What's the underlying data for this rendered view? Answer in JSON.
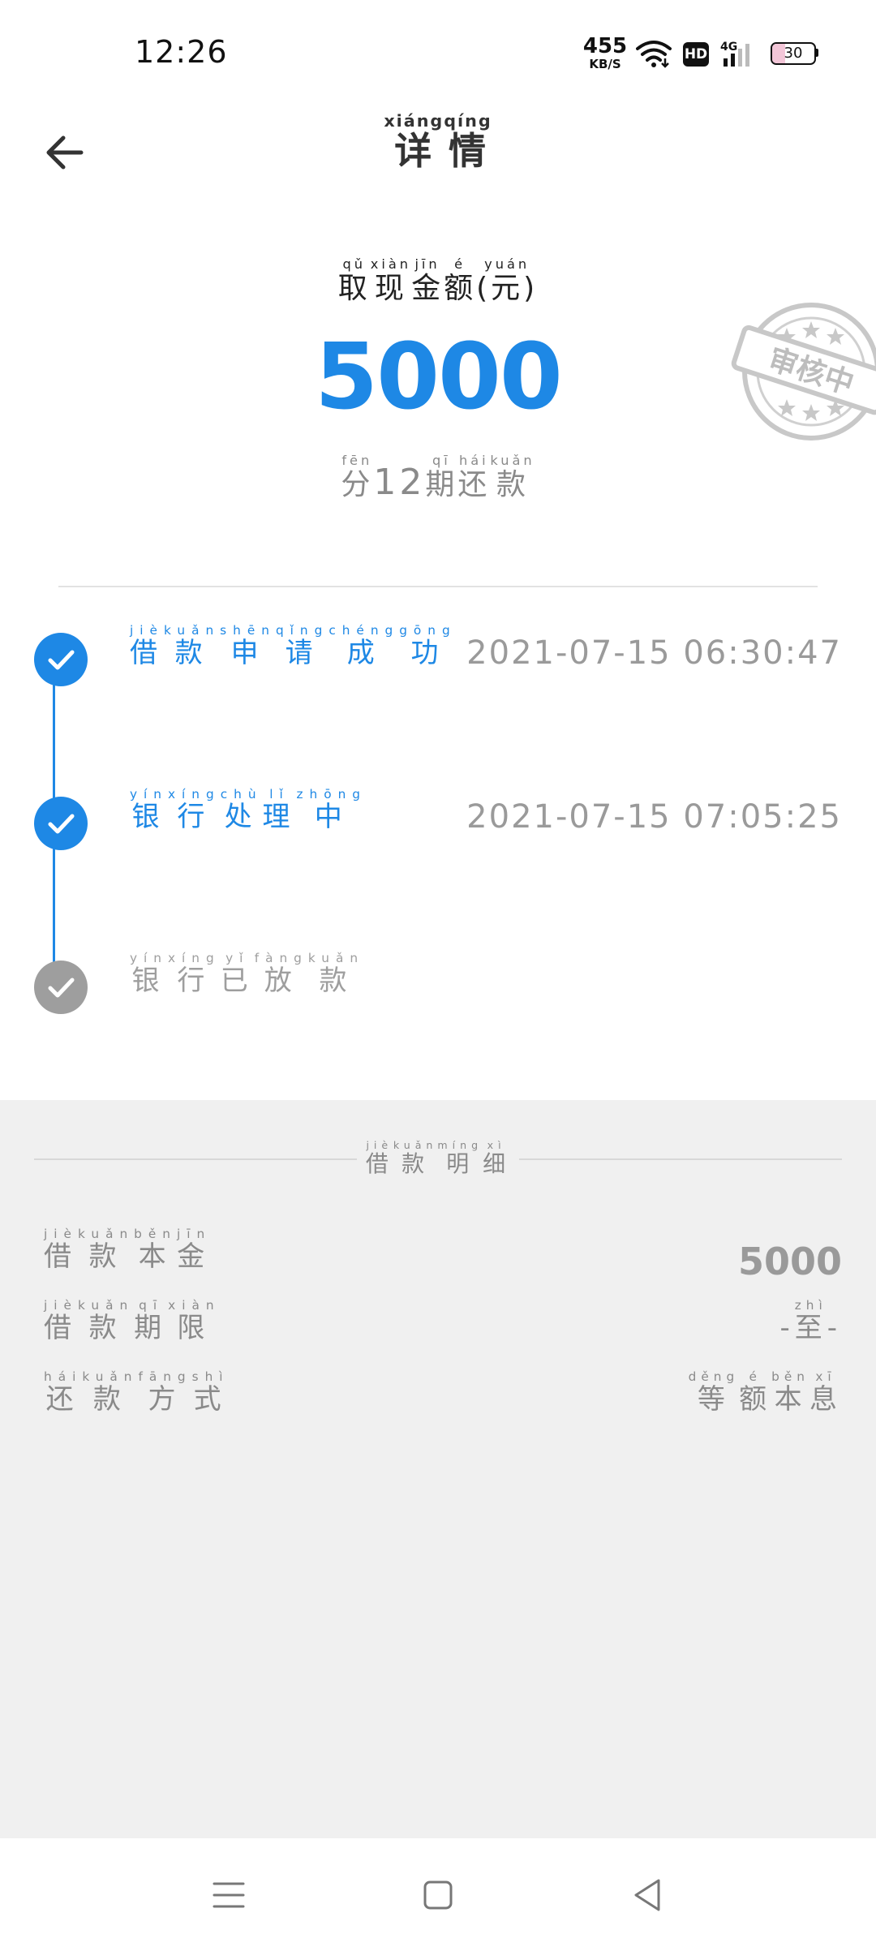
{
  "status_bar": {
    "time": "12:26",
    "net_speed_value": "455",
    "net_speed_unit": "KB/S",
    "hd_label": "HD",
    "network_type": "4G",
    "battery_level": "30",
    "battery_fill_color": "#f3c6d8"
  },
  "header": {
    "title": [
      {
        "char": "详",
        "pinyin": "xiáng"
      },
      {
        "char": "情",
        "pinyin": "qíng"
      }
    ],
    "back_icon": "arrow-left-icon"
  },
  "amount": {
    "label": [
      {
        "char": "取",
        "pinyin": "qǔ"
      },
      {
        "char": "现",
        "pinyin": "xiàn"
      },
      {
        "char": "金",
        "pinyin": "jīn"
      },
      {
        "char": "额",
        "pinyin": "é"
      },
      {
        "char": "(",
        "pinyin": ""
      },
      {
        "char": "元",
        "pinyin": "yuán"
      },
      {
        "char": ")",
        "pinyin": ""
      }
    ],
    "value": "5000",
    "term": [
      {
        "char": "分",
        "pinyin": "fēn"
      },
      {
        "char": "12",
        "pinyin": ""
      },
      {
        "char": "期",
        "pinyin": "qī"
      },
      {
        "char": "还",
        "pinyin": "hái"
      },
      {
        "char": "款",
        "pinyin": "kuǎn"
      }
    ],
    "stamp_text": "审核中",
    "accent_color": "#1e88e5"
  },
  "timeline": {
    "steps": [
      {
        "label": [
          {
            "char": "借",
            "pinyin": "jiè"
          },
          {
            "char": "款",
            "pinyin": "kuǎn"
          },
          {
            "char": "申",
            "pinyin": "shēn"
          },
          {
            "char": "请",
            "pinyin": "qǐng"
          },
          {
            "char": "成",
            "pinyin": "chéng"
          },
          {
            "char": "功",
            "pinyin": "gōng"
          }
        ],
        "time": "2021-07-15 06:30:47",
        "status": "done",
        "color": "#1e88e5"
      },
      {
        "label": [
          {
            "char": "银",
            "pinyin": "yín"
          },
          {
            "char": "行",
            "pinyin": "xíng"
          },
          {
            "char": "处",
            "pinyin": "chù"
          },
          {
            "char": "理",
            "pinyin": "lǐ"
          },
          {
            "char": "中",
            "pinyin": "zhōng"
          }
        ],
        "time": "2021-07-15 07:05:25",
        "status": "done",
        "color": "#1e88e5"
      },
      {
        "label": [
          {
            "char": "银",
            "pinyin": "yín"
          },
          {
            "char": "行",
            "pinyin": "xíng"
          },
          {
            "char": "已",
            "pinyin": "yǐ"
          },
          {
            "char": "放",
            "pinyin": "fàng"
          },
          {
            "char": "款",
            "pinyin": "kuǎn"
          }
        ],
        "time": "",
        "status": "pending",
        "color": "#9e9e9e"
      }
    ]
  },
  "details": {
    "title": [
      {
        "char": "借",
        "pinyin": "jiè"
      },
      {
        "char": "款",
        "pinyin": "kuǎn"
      },
      {
        "char": "明",
        "pinyin": "míng"
      },
      {
        "char": "细",
        "pinyin": "xì"
      }
    ],
    "rows": [
      {
        "label": [
          {
            "char": "借",
            "pinyin": "jiè"
          },
          {
            "char": "款",
            "pinyin": "kuǎn"
          },
          {
            "char": "本",
            "pinyin": "běn"
          },
          {
            "char": "金",
            "pinyin": "jīn"
          }
        ],
        "value": [
          {
            "char": "5000",
            "pinyin": ""
          }
        ]
      },
      {
        "label": [
          {
            "char": "借",
            "pinyin": "jiè"
          },
          {
            "char": "款",
            "pinyin": "kuǎn"
          },
          {
            "char": "期",
            "pinyin": "qī"
          },
          {
            "char": "限",
            "pinyin": "xiàn"
          }
        ],
        "value": [
          {
            "char": "-",
            "pinyin": ""
          },
          {
            "char": "至",
            "pinyin": "zhì"
          },
          {
            "char": "-",
            "pinyin": ""
          }
        ]
      },
      {
        "label": [
          {
            "char": "还",
            "pinyin": "hái"
          },
          {
            "char": "款",
            "pinyin": "kuǎn"
          },
          {
            "char": "方",
            "pinyin": "fāng"
          },
          {
            "char": "式",
            "pinyin": "shì"
          }
        ],
        "value": [
          {
            "char": "等",
            "pinyin": "děng"
          },
          {
            "char": "额",
            "pinyin": "é"
          },
          {
            "char": "本",
            "pinyin": "běn"
          },
          {
            "char": "息",
            "pinyin": "xī"
          }
        ]
      }
    ]
  },
  "nav_bar": {
    "menu_icon": "menu-icon",
    "home_icon": "home-square-icon",
    "back_icon": "back-triangle-icon"
  }
}
